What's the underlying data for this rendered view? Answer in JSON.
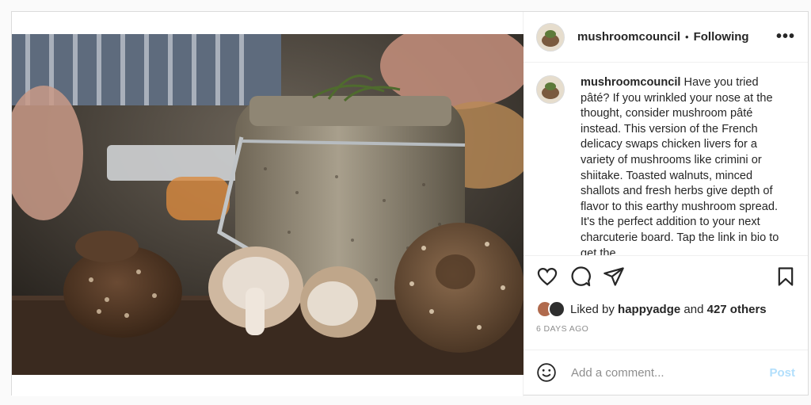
{
  "post": {
    "username": "mushroomcouncil",
    "separator": "•",
    "follow_status": "Following",
    "more_label": "•••",
    "caption_user": "mushroomcouncil",
    "caption_text": " Have you tried pâté? If you wrinkled your nose at the thought, consider mushroom pâté instead. This version of the French delicacy swaps chicken livers for a variety of mushrooms like crimini or shiitake. Toasted walnuts, minced shallots and fresh herbs give depth of flavor to this earthy mushroom spread. It's the perfect addition to your next charcuterie board. Tap the link in bio to get the",
    "liked_prefix": "Liked by ",
    "liked_user": "happyadge",
    "liked_mid": " and ",
    "liked_count": "427 others",
    "posted_ago": "6 DAYS AGO",
    "comment_placeholder": "Add a comment...",
    "post_label": "Post"
  },
  "icons": {
    "like": "heart-icon",
    "comment": "comment-icon",
    "share": "paper-plane-icon",
    "save": "bookmark-icon",
    "emoji": "smiley-icon"
  },
  "colors": {
    "post_button_disabled": "#b2dffc",
    "muted_text": "#8e8e8e",
    "border": "#dbdbdb"
  }
}
